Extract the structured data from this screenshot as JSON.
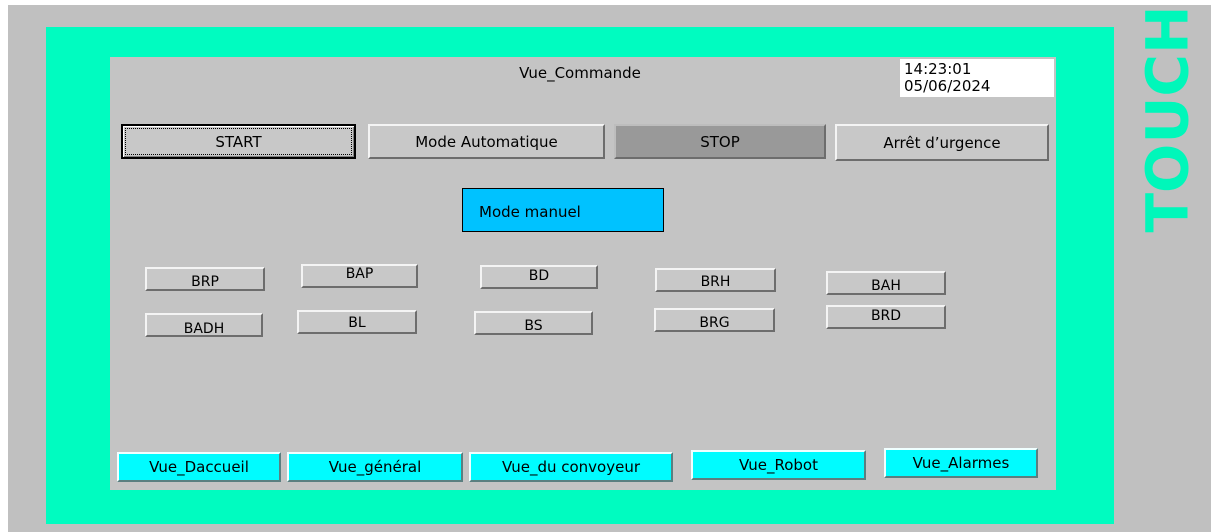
{
  "brand": {
    "text": "TOUCH"
  },
  "colors": {
    "frame": "#00fcc0",
    "brand": "#00f7ba",
    "mode_manuel_bg": "#00c2ff",
    "nav_bg": "#00fcff"
  },
  "header": {
    "title": "Vue_Commande",
    "time": "14:23:01",
    "date": "05/06/2024"
  },
  "controls": {
    "start": "START",
    "auto": "Mode Automatique",
    "stop": "STOP",
    "emergency": "Arrêt d’urgence",
    "manual": "Mode manuel"
  },
  "manual_buttons": {
    "brp": "BRP",
    "bap": "BAP",
    "bd": "BD",
    "brh": "BRH",
    "bah": "BAH",
    "badh": "BADH",
    "bl": "BL",
    "bs": "BS",
    "brg": "BRG",
    "brd": "BRD"
  },
  "nav": {
    "daccueil": "Vue_Daccueil",
    "general": "Vue_général",
    "convoyeur": "Vue_du convoyeur",
    "robot": "Vue_Robot",
    "alarmes": "Vue_Alarmes"
  }
}
